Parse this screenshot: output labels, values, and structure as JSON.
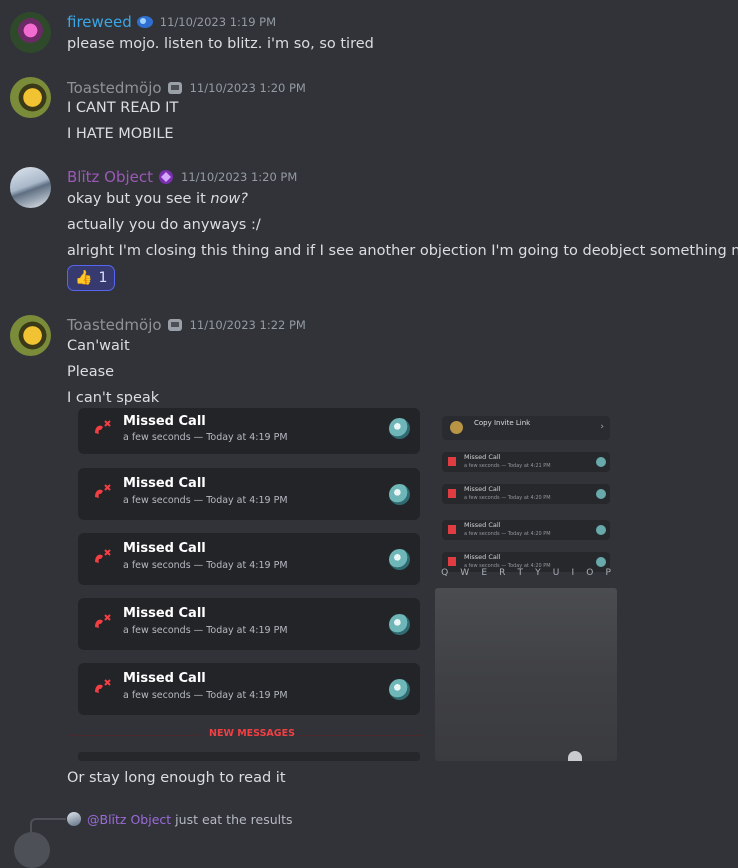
{
  "colors": {
    "background": "#313338",
    "fireweed": "#3ba7e6",
    "toastedmojo": "#8e9297",
    "blitz": "#9b59b6",
    "missed_call_red": "#f23f43"
  },
  "messages": [
    {
      "username": "fireweed",
      "timestamp": "11/10/2023 1:19 PM",
      "lines": [
        "please mojo. listen to blitz. i'm so, so tired"
      ]
    },
    {
      "username": "Toastedmöjo",
      "timestamp": "11/10/2023 1:20 PM",
      "lines": [
        "I CANT READ IT",
        "I HATE MOBILE"
      ]
    },
    {
      "username": "Blītz Object",
      "timestamp": "11/10/2023 1:20 PM",
      "line1_prefix": "okay but you see it ",
      "line1_emph": "now?",
      "lines": [
        "actually you do anyways :/",
        "alright I'm closing this thing and if I see another objection I'm going to deobject something nasty"
      ],
      "reaction": {
        "emoji": "👍",
        "count": "1"
      }
    },
    {
      "username": "Toastedmöjo",
      "timestamp": "11/10/2023 1:22 PM",
      "lines": [
        "Can'wait",
        "Please",
        "I can't speak"
      ],
      "after_image": "Or stay long enough to read it"
    }
  ],
  "embed": {
    "calls": [
      {
        "title": "Missed Call",
        "sub": "a few seconds — Today at 4:19 PM"
      },
      {
        "title": "Missed Call",
        "sub": "a few seconds — Today at 4:19 PM"
      },
      {
        "title": "Missed Call",
        "sub": "a few seconds — Today at 4:19 PM"
      },
      {
        "title": "Missed Call",
        "sub": "a few seconds — Today at 4:19 PM"
      },
      {
        "title": "Missed Call",
        "sub": "a few seconds — Today at 4:19 PM"
      }
    ],
    "new_messages": "NEW MESSAGES",
    "phone": {
      "invite": "Copy Invite Link",
      "mini_calls": [
        {
          "title": "Missed Call",
          "sub": "a few seconds — Today at 4:21 PM"
        },
        {
          "title": "Missed Call",
          "sub": "a few seconds — Today at 4:20 PM"
        },
        {
          "title": "Missed Call",
          "sub": "a few seconds — Today at 4:20 PM"
        },
        {
          "title": "Missed Call",
          "sub": "a few seconds — Today at 4:20 PM"
        }
      ],
      "keys": [
        "Q",
        "W",
        "E",
        "R",
        "T",
        "Y",
        "U",
        "I",
        "O",
        "P"
      ]
    }
  },
  "reply_preview": {
    "mention": "@Blītz Object",
    "text": "just eat the results"
  }
}
